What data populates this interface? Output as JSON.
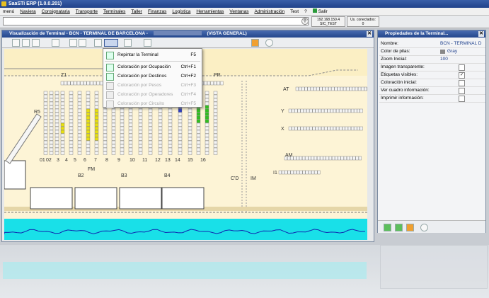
{
  "app": {
    "title": "SaaSTi ERP  (1.0.0.201)"
  },
  "menubar": {
    "items": [
      "menú",
      "Naviera",
      "Consignataria",
      "Transporte",
      "Terminales",
      "Taller",
      "Finanzas",
      "Logística",
      "Herramientas",
      "Ventanas",
      "Administración",
      "Test",
      "?",
      "Salir"
    ]
  },
  "status": {
    "ip": "192.168.150.4",
    "env": "SIC_TEST",
    "connected_label": "Us. conectados:",
    "connected_count": "0"
  },
  "main_window": {
    "title": "Visualización de Terminal - BCN - TERMINAL DE BARCELONA -",
    "title_suffix": "(VISTA GENERAL)",
    "close": "✕"
  },
  "dropdown": {
    "items": [
      {
        "label": "Repintar la Terminal",
        "shortcut": "F5",
        "enabled": true
      },
      {
        "label": "Coloración por Ocupación",
        "shortcut": "Ctrl+F1",
        "enabled": true
      },
      {
        "label": "Coloración por Destinos",
        "shortcut": "Ctrl+F2",
        "enabled": true
      },
      {
        "label": "Coloración por Pesos",
        "shortcut": "Ctrl+F3",
        "enabled": false
      },
      {
        "label": "Coloración por Operadores",
        "shortcut": "Ctrl+F4",
        "enabled": false
      },
      {
        "label": "Coloración por Circuito",
        "shortcut": "Ctrl+F5",
        "enabled": false
      }
    ]
  },
  "terminal": {
    "zone_labels": [
      "Z1",
      "R5",
      "PR",
      "AT",
      "Y",
      "X",
      "AM",
      "I1",
      "C'D",
      "IM",
      "FM",
      "B2",
      "B3",
      "B4"
    ],
    "row_numbers": [
      "01",
      "02",
      "3",
      "4",
      "5",
      "6",
      "7",
      "8",
      "9",
      "10",
      "11",
      "12",
      "13",
      "14",
      "15",
      "16"
    ],
    "colors": {
      "ground": "#fdf4d6",
      "water": "#19e0e8",
      "slot": "#f4f4f4",
      "occupied_yellow": "#e8e010",
      "occupied_blue": "#3040c0",
      "occupied_green": "#30c020"
    }
  },
  "properties": {
    "title": "Propiedades de la Terminal...",
    "rows": [
      {
        "key": "Nombre:",
        "value": "BCN - TERMINAL D"
      },
      {
        "key": "Color de pilas:",
        "value": "Gray"
      },
      {
        "key": "Zoom Inicial:",
        "value": "100"
      },
      {
        "key": "Imagen transparente:",
        "check": false
      },
      {
        "key": "Etiquetas visibles:",
        "check": true
      },
      {
        "key": "Coloración inicial:",
        "check": false
      },
      {
        "key": "Ver cuadro información:",
        "check": false
      },
      {
        "key": "Imprimir información:",
        "check": false
      }
    ]
  }
}
